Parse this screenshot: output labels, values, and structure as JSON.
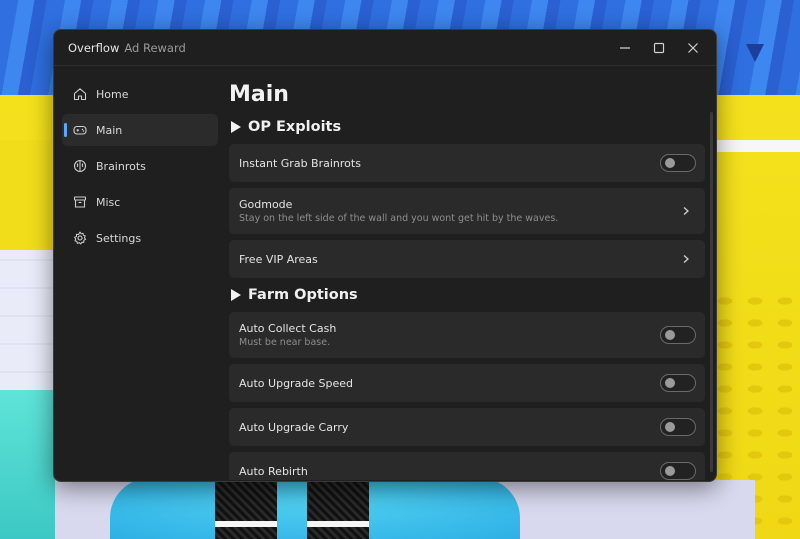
{
  "window": {
    "title": "Overflow",
    "subtitle": "Ad Reward"
  },
  "sidebar": {
    "items": [
      {
        "label": "Home",
        "icon": "home-icon",
        "active": false
      },
      {
        "label": "Main",
        "icon": "gamepad-icon",
        "active": true
      },
      {
        "label": "Brainrots",
        "icon": "brain-icon",
        "active": false
      },
      {
        "label": "Misc",
        "icon": "archive-icon",
        "active": false
      },
      {
        "label": "Settings",
        "icon": "gear-icon",
        "active": false
      }
    ]
  },
  "main": {
    "title": "Main",
    "sections": [
      {
        "title": "OP Exploits",
        "rows": [
          {
            "title": "Instant Grab Brainrots",
            "desc": "",
            "control": "toggle",
            "on": false
          },
          {
            "title": "Godmode",
            "desc": "Stay on the left side of the wall and you wont get hit by the waves.",
            "control": "chevron"
          },
          {
            "title": "Free VIP Areas",
            "desc": "",
            "control": "chevron"
          }
        ]
      },
      {
        "title": "Farm Options",
        "rows": [
          {
            "title": "Auto Collect Cash",
            "desc": "Must be near base.",
            "control": "toggle",
            "on": false
          },
          {
            "title": "Auto Upgrade Speed",
            "desc": "",
            "control": "toggle",
            "on": false
          },
          {
            "title": "Auto Upgrade Carry",
            "desc": "",
            "control": "toggle",
            "on": false
          },
          {
            "title": "Auto Rebirth",
            "desc": "",
            "control": "toggle",
            "on": false
          }
        ]
      }
    ]
  },
  "colors": {
    "window_bg": "#1f1f1f",
    "row_bg": "#2a2a2a",
    "accent": "#5aa7ff",
    "text": "#e4e4e4",
    "muted": "#8e8e8e"
  }
}
